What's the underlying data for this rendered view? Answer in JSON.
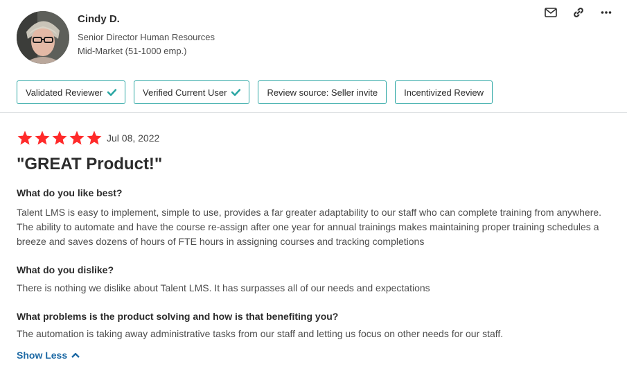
{
  "reviewer": {
    "name": "Cindy D.",
    "title": "Senior Director Human Resources",
    "segment": "Mid-Market (51-1000 emp.)"
  },
  "actions": {
    "icons": [
      "envelope-icon",
      "link-icon",
      "more-icon"
    ]
  },
  "badges": [
    {
      "label": "Validated Reviewer",
      "checked": true
    },
    {
      "label": "Verified Current User",
      "checked": true
    },
    {
      "label": "Review source: Seller invite",
      "checked": false
    },
    {
      "label": "Incentivized Review",
      "checked": false
    }
  ],
  "review": {
    "rating": 5,
    "rating_max": 5,
    "date": "Jul 08, 2022",
    "headline": "\"GREAT Product!\"",
    "qa": [
      {
        "question": "What do you like best?",
        "answer": "Talent LMS is easy to implement, simple to use, provides a far greater adaptability to our staff who can complete training from anywhere. The ability to automate and have the course re-assign after one year for annual trainings makes maintaining proper training schedules a breeze and saves dozens of hours of FTE hours in assigning courses and tracking completions"
      },
      {
        "question": "What do you dislike?",
        "answer": "There is nothing we dislike about Talent LMS. It has surpasses all of our needs and expectations"
      },
      {
        "question": "What problems is the product solving and how is that benefiting you?",
        "answer": "The automation is taking away administrative tasks from our staff and letting us focus on other needs for our staff."
      }
    ],
    "show_less_label": "Show Less"
  },
  "colors": {
    "star": "#ff2a2a",
    "badge_border": "#2aa6a3",
    "check": "#2aa6a3",
    "link": "#1e6aa5"
  }
}
